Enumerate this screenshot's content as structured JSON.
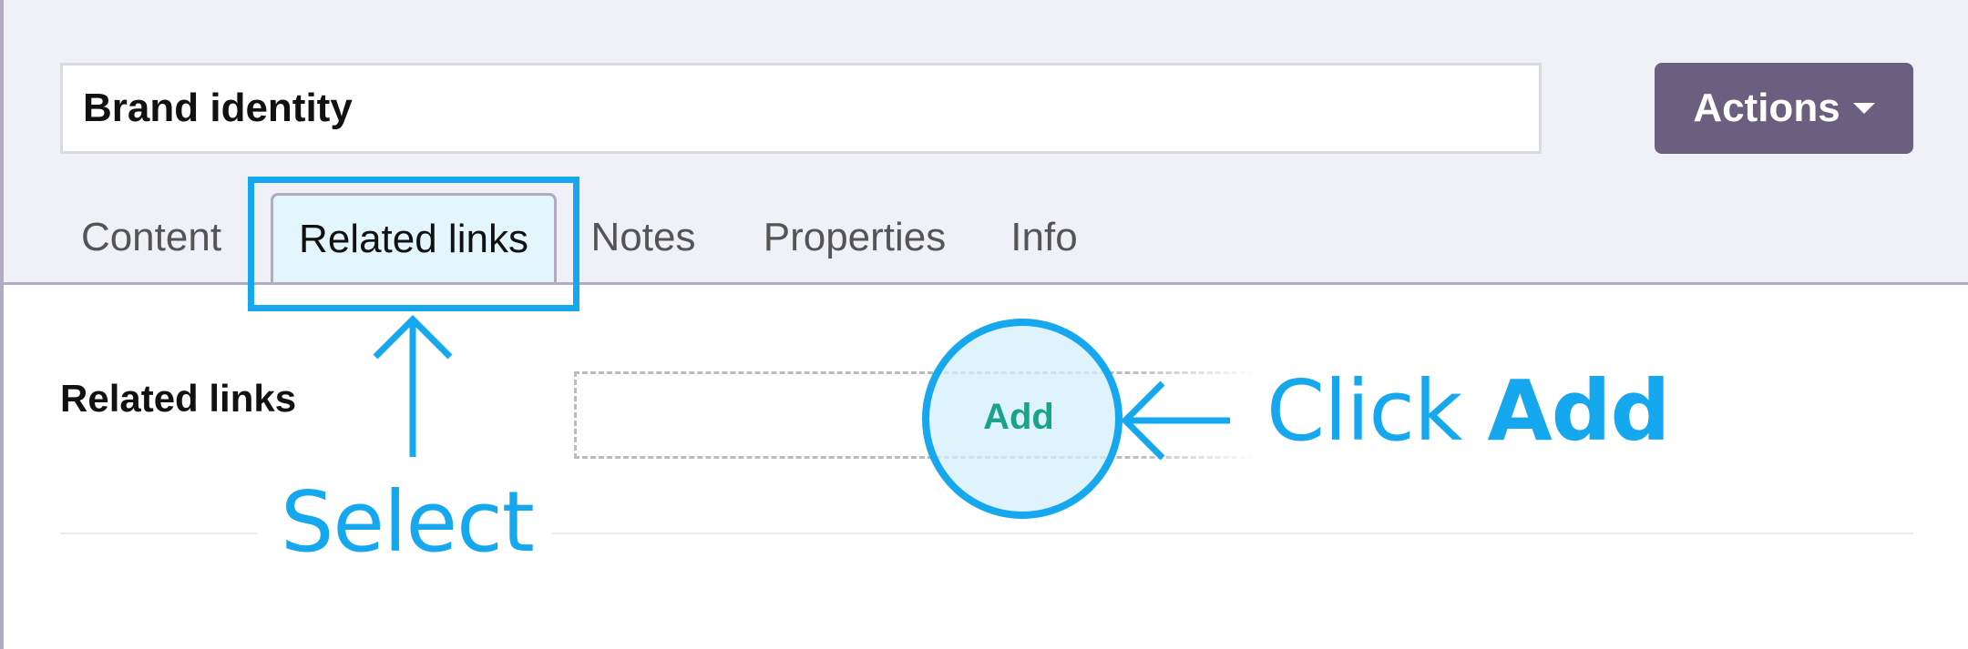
{
  "header": {
    "title_value": "Brand identity",
    "actions_label": "Actions"
  },
  "tabs": [
    {
      "label": "Content",
      "active": false
    },
    {
      "label": "Related links",
      "active": true
    },
    {
      "label": "Notes",
      "active": false
    },
    {
      "label": "Properties",
      "active": false
    },
    {
      "label": "Info",
      "active": false
    }
  ],
  "section": {
    "label": "Related links",
    "add_label": "Add"
  },
  "annotations": {
    "select_text": "Select",
    "click_text": "Click",
    "click_emphasis": "Add"
  },
  "colors": {
    "accent": "#16a8ee",
    "actions_bg": "#6a5f7e",
    "add_text": "#1aa38a",
    "header_bg": "#eff1f6"
  },
  "icons": {
    "actions_caret": "caret-down-icon",
    "select_arrow": "arrow-up-icon",
    "click_arrow": "arrow-left-icon"
  }
}
